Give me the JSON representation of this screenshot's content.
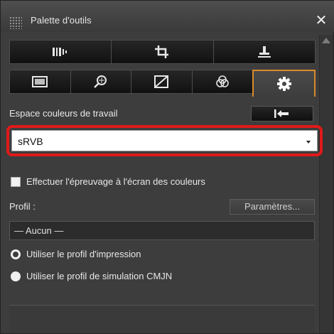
{
  "window": {
    "title": "Palette d'outils",
    "close_glyph": "✕"
  },
  "toolbar_row1": [
    {
      "icon": "adjust-icon"
    },
    {
      "icon": "crop-icon"
    },
    {
      "icon": "stamp-icon"
    }
  ],
  "toolbar_row2": [
    {
      "icon": "image-icon"
    },
    {
      "icon": "zoom-icon"
    },
    {
      "icon": "tone-curve-icon"
    },
    {
      "icon": "color-circles-icon"
    },
    {
      "icon": "gear-icon",
      "active": true
    }
  ],
  "working_space": {
    "label": "Espace couleurs de travail",
    "value": "sRVB"
  },
  "proofing": {
    "label": "Effectuer l'épreuvage à l'écran des couleurs"
  },
  "profile": {
    "label": "Profil :",
    "params_label": "Paramètres...",
    "value": "— Aucun —"
  },
  "radios": [
    {
      "label": "Utiliser le profil d'impression",
      "selected": true
    },
    {
      "label": "Utiliser le profil de simulation CMJN",
      "selected": false
    }
  ],
  "colors": {
    "accent": "#d98a2b",
    "highlight_ring": "#e01919",
    "panel_bg": "#3d3d3d"
  }
}
